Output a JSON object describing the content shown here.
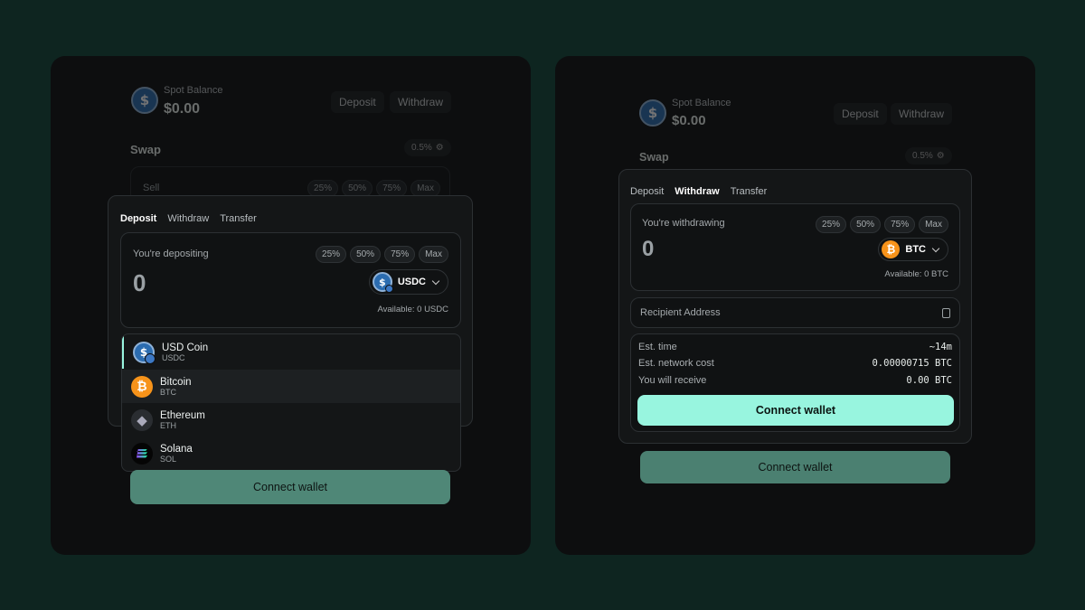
{
  "left": {
    "balance_label": "Spot Balance",
    "balance_value": "$0.00",
    "deposit_btn": "Deposit",
    "withdraw_btn": "Withdraw",
    "swap_title": "Swap",
    "slippage": "0.5%",
    "sell_label": "Sell",
    "sell_pills": [
      "25%",
      "50%",
      "75%",
      "Max"
    ],
    "tabs": [
      "Deposit",
      "Withdraw",
      "Transfer"
    ],
    "active_tab": "Deposit",
    "depositing_label": "You're depositing",
    "pills": [
      "25%",
      "50%",
      "75%",
      "Max"
    ],
    "amount": "0",
    "token": "USDC",
    "available": "Available: 0 USDC",
    "tokens": [
      {
        "name": "USD Coin",
        "symbol": "USDC",
        "icon": "usdc-icon"
      },
      {
        "name": "Bitcoin",
        "symbol": "BTC",
        "icon": "btc-icon"
      },
      {
        "name": "Ethereum",
        "symbol": "ETH",
        "icon": "eth-icon"
      },
      {
        "name": "Solana",
        "symbol": "SOL",
        "icon": "sol-icon"
      }
    ],
    "connect_wallet": "Connect wallet"
  },
  "right": {
    "balance_label": "Spot Balance",
    "balance_value": "$0.00",
    "deposit_btn": "Deposit",
    "withdraw_btn": "Withdraw",
    "swap_title": "Swap",
    "slippage": "0.5%",
    "tabs": [
      "Deposit",
      "Withdraw",
      "Transfer"
    ],
    "active_tab": "Withdraw",
    "withdrawing_label": "You're withdrawing",
    "pills": [
      "25%",
      "50%",
      "75%",
      "Max"
    ],
    "amount": "0",
    "token": "BTC",
    "available": "Available: 0 BTC",
    "recipient_placeholder": "Recipient Address",
    "est": [
      {
        "label": "Est. time",
        "value": "~14m"
      },
      {
        "label": "Est. network cost",
        "value": "0.00000715 BTC"
      },
      {
        "label": "You will receive",
        "value": "0.00 BTC"
      }
    ],
    "connect_wallet": "Connect wallet"
  },
  "colors": {
    "background": "#0e2520",
    "panel": "#0d0e0f",
    "accent": "#98f5df",
    "accent_dim": "#4f8777",
    "bitcoin": "#f7931a",
    "usdc": "#2b6cb0"
  }
}
